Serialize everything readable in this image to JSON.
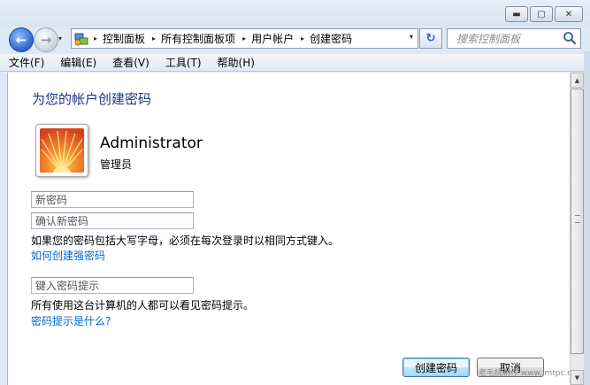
{
  "window": {
    "buttons": {
      "minimize": "▬",
      "maximize": "▢",
      "close": "✕"
    }
  },
  "nav": {
    "back_glyph": "←",
    "forward_glyph": "→",
    "dropdown_glyph": "▾"
  },
  "address": {
    "segments": [
      {
        "label": "控制面板"
      },
      {
        "label": "所有控制面板项"
      },
      {
        "label": "用户帐户"
      },
      {
        "label": "创建密码"
      }
    ],
    "separator": "▸",
    "dropdown_glyph": "▾",
    "refresh_glyph": "↻"
  },
  "search": {
    "placeholder": "搜索控制面板"
  },
  "menu": [
    {
      "label": "文件(F)"
    },
    {
      "label": "编辑(E)"
    },
    {
      "label": "查看(V)"
    },
    {
      "label": "工具(T)"
    },
    {
      "label": "帮助(H)"
    }
  ],
  "page": {
    "title": "为您的帐户创建密码",
    "user": {
      "name": "Administrator",
      "role": "管理员"
    },
    "fields": {
      "new_password_placeholder": "新密码",
      "confirm_password_placeholder": "确认新密码",
      "hint_placeholder": "键入密码提示"
    },
    "case_notice": "如果您的密码包括大写字母，必须在每次登录时以相同方式键入。",
    "strong_password_link": "如何创建强密码",
    "hint_notice": "所有使用这台计算机的人都可以看见密码提示。",
    "hint_link": "密码提示是什么?",
    "buttons": {
      "create": "创建密码",
      "cancel": "取消"
    },
    "watermark": "老毛桃制作 www.lmtpc.com"
  },
  "colors": {
    "title": "#1e3287",
    "link": "#0066cc"
  }
}
